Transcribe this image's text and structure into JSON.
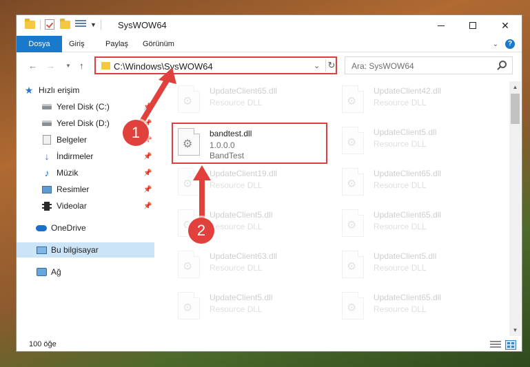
{
  "window": {
    "title": "SysWOW64",
    "controls": {
      "minimize": "",
      "maximize": "",
      "close": "✕"
    }
  },
  "ribbon": {
    "tabs": [
      "Dosya",
      "Giriş",
      "Paylaş",
      "Görünüm"
    ],
    "help": "?"
  },
  "address": {
    "path": "C:\\Windows\\SysWOW64",
    "search_placeholder": "Ara: SysWOW64"
  },
  "sidebar": {
    "items": [
      {
        "label": "Hızlı erişim",
        "icon": "star-icon",
        "pinned": false
      },
      {
        "label": "Yerel Disk (C:)",
        "icon": "disk-icon",
        "pinned": true
      },
      {
        "label": "Yerel Disk (D:)",
        "icon": "disk-icon",
        "pinned": true
      },
      {
        "label": "Belgeler",
        "icon": "documents-icon",
        "pinned": true
      },
      {
        "label": "İndirmeler",
        "icon": "download-icon",
        "pinned": true
      },
      {
        "label": "Müzik",
        "icon": "music-icon",
        "pinned": true
      },
      {
        "label": "Resimler",
        "icon": "pictures-icon",
        "pinned": true
      },
      {
        "label": "Videolar",
        "icon": "video-icon",
        "pinned": true
      },
      {
        "label": "OneDrive",
        "icon": "onedrive-icon",
        "pinned": false
      },
      {
        "label": "Bu bilgisayar",
        "icon": "this-pc-icon",
        "pinned": false,
        "selected": true
      },
      {
        "label": "Ağ",
        "icon": "network-icon",
        "pinned": false
      }
    ]
  },
  "files": {
    "left": [
      {
        "name": "UpdateClient65.dll",
        "type": "Resource DLL"
      },
      {
        "name": "bandtest.dll",
        "version": "1.0.0.0",
        "type": "BandTest",
        "highlighted": true
      },
      {
        "name": "UpdateClient19.dll",
        "type": "Resource DLL"
      },
      {
        "name": "UpdateClient5.dll",
        "type": "Resource DLL"
      },
      {
        "name": "UpdateClient63.dll",
        "type": "Resource DLL"
      },
      {
        "name": "UpdateClient5.dll",
        "type": "Resource DLL"
      }
    ],
    "right": [
      {
        "name": "UpdateClient42.dll",
        "type": "Resource DLL"
      },
      {
        "name": "UpdateClient5.dll",
        "type": "Resource DLL"
      },
      {
        "name": "UpdateClient65.dll",
        "type": "Resource DLL"
      },
      {
        "name": "UpdateClient65.dll",
        "type": "Resource DLL"
      },
      {
        "name": "UpdateClient5.dll",
        "type": "Resource DLL"
      },
      {
        "name": "UpdateClient65.dll",
        "type": "Resource DLL"
      }
    ]
  },
  "status": {
    "count": "100 öğe"
  },
  "annotations": {
    "step1": "1",
    "step2": "2",
    "color": "#e0413c"
  }
}
